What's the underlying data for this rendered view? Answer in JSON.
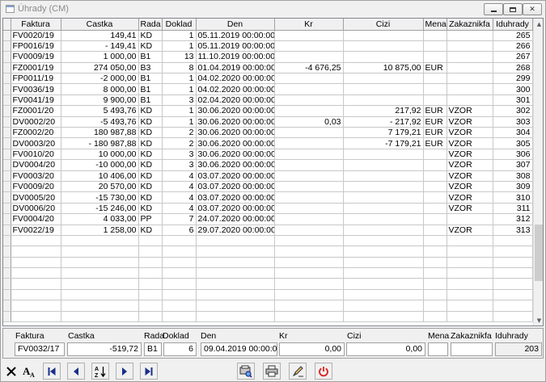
{
  "window": {
    "title": "Úhrady (CM)"
  },
  "grid": {
    "columns": [
      "Faktura",
      "Castka",
      "Rada",
      "Doklad",
      "Den",
      "Kr",
      "Cizi",
      "Mena",
      "Zakaznikfa",
      "Iduhrady"
    ],
    "rows": [
      [
        "FV0020/19",
        "149,41",
        "KD",
        "1",
        "05.11.2019 00:00:00",
        "",
        "",
        "",
        "",
        "265"
      ],
      [
        "FP0016/19",
        "- 149,41",
        "KD",
        "1",
        "05.11.2019 00:00:00",
        "",
        "",
        "",
        "",
        "266"
      ],
      [
        "FV0009/19",
        "1 000,00",
        "B1",
        "13",
        "11.10.2019 00:00:00",
        "",
        "",
        "",
        "",
        "267"
      ],
      [
        "FZ0001/19",
        "274 050,00",
        "B3",
        "8",
        "01.04.2019 00:00:00",
        "-4 676,25",
        "10 875,00",
        "EUR",
        "",
        "268"
      ],
      [
        "FP0011/19",
        "-2 000,00",
        "B1",
        "1",
        "04.02.2020 00:00:00",
        "",
        "",
        "",
        "",
        "299"
      ],
      [
        "FV0036/19",
        "8 000,00",
        "B1",
        "1",
        "04.02.2020 00:00:00",
        "",
        "",
        "",
        "",
        "300"
      ],
      [
        "FV0041/19",
        "9 900,00",
        "B1",
        "3",
        "02.04.2020 00:00:00",
        "",
        "",
        "",
        "",
        "301"
      ],
      [
        "FZ0001/20",
        "5 493,76",
        "KD",
        "1",
        "30.06.2020 00:00:00",
        "",
        "217,92",
        "EUR",
        "VZOR",
        "302"
      ],
      [
        "DV0002/20",
        "-5 493,76",
        "KD",
        "1",
        "30.06.2020 00:00:00",
        "0,03",
        "- 217,92",
        "EUR",
        "VZOR",
        "303"
      ],
      [
        "FZ0002/20",
        "180 987,88",
        "KD",
        "2",
        "30.06.2020 00:00:00",
        "",
        "7 179,21",
        "EUR",
        "VZOR",
        "304"
      ],
      [
        "DV0003/20",
        "- 180 987,88",
        "KD",
        "2",
        "30.06.2020 00:00:00",
        "",
        "-7 179,21",
        "EUR",
        "VZOR",
        "305"
      ],
      [
        "FV0010/20",
        "10 000,00",
        "KD",
        "3",
        "30.06.2020 00:00:00",
        "",
        "",
        "",
        "VZOR",
        "306"
      ],
      [
        "DV0004/20",
        "-10 000,00",
        "KD",
        "3",
        "30.06.2020 00:00:00",
        "",
        "",
        "",
        "VZOR",
        "307"
      ],
      [
        "FV0003/20",
        "10 406,00",
        "KD",
        "4",
        "03.07.2020 00:00:00",
        "",
        "",
        "",
        "VZOR",
        "308"
      ],
      [
        "FV0009/20",
        "20 570,00",
        "KD",
        "4",
        "03.07.2020 00:00:00",
        "",
        "",
        "",
        "VZOR",
        "309"
      ],
      [
        "DV0005/20",
        "-15 730,00",
        "KD",
        "4",
        "03.07.2020 00:00:00",
        "",
        "",
        "",
        "VZOR",
        "310"
      ],
      [
        "DV0006/20",
        "-15 246,00",
        "KD",
        "4",
        "03.07.2020 00:00:00",
        "",
        "",
        "",
        "VZOR",
        "311"
      ],
      [
        "FV0004/20",
        "4 033,00",
        "PP",
        "7",
        "24.07.2020 00:00:00",
        "",
        "",
        "",
        "",
        "312"
      ],
      [
        "FV0022/19",
        "1 258,00",
        "KD",
        "6",
        "29.07.2020 00:00:00",
        "",
        "",
        "",
        "VZOR",
        "313"
      ]
    ],
    "empty_rows": 8
  },
  "detail": {
    "labels": {
      "faktura": "Faktura",
      "castka": "Castka",
      "rada": "Rada",
      "doklad": "Doklad",
      "den": "Den",
      "kr": "Kr",
      "cizi": "Cizi",
      "mena": "Mena",
      "zakaznikfa": "Zakaznikfa",
      "iduhrady": "Iduhrady"
    },
    "values": {
      "faktura": "FV0032/17",
      "castka": "-519,72",
      "rada": "B1",
      "doklad": "6",
      "den": "09.04.2019 00:00:00",
      "kr": "0,00",
      "cizi": "0,00",
      "mena": "",
      "zakaznikfa": "",
      "iduhrady": "203"
    }
  },
  "toolbar": {
    "icons": [
      "close-icon",
      "font-icon",
      "first-record-icon",
      "previous-record-icon",
      "sort-az-icon",
      "next-record-icon",
      "last-record-icon",
      "search-print-icon",
      "printer-icon",
      "edit-pencil-icon",
      "power-icon"
    ]
  },
  "colors": {
    "power_red": "#e02020",
    "nav_blue": "#1a2f8a"
  }
}
